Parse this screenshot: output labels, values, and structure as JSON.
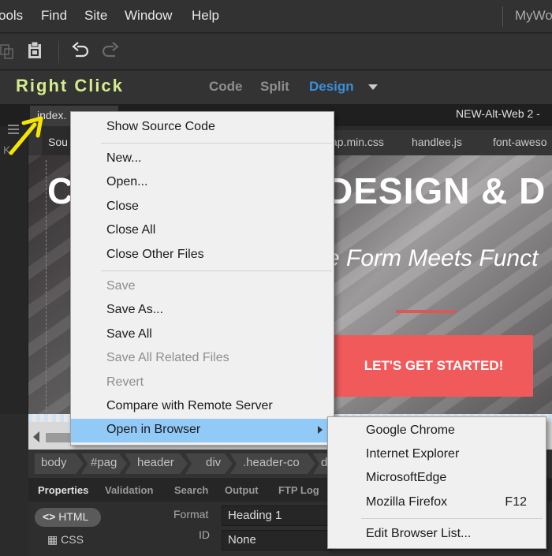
{
  "menubar": {
    "items": [
      "ools",
      "Find",
      "Site",
      "Window",
      "Help"
    ],
    "app_title": "MyWo"
  },
  "toolbar": {
    "icons": [
      "copy-icon",
      "paste-icon",
      "undo-icon",
      "redo-icon"
    ]
  },
  "viewbar": {
    "annotation": "Right Click",
    "code": "Code",
    "split": "Split",
    "design": "Design",
    "active": "Design"
  },
  "doc": {
    "tab_label": "index.",
    "path": "NEW-Alt-Web 2 -"
  },
  "related_files": {
    "source": "Sou",
    "files": [
      "ap.min.css",
      "handlee.js",
      "font-aweso"
    ]
  },
  "hero": {
    "title_left": "C",
    "title_right": "DESIGN & D",
    "subtitle": "e Form Meets Funct",
    "cta": "LET'S GET STARTED!",
    "cta_color": "#f05a5b"
  },
  "tags": [
    "body",
    "#pag",
    "header",
    "div",
    ".header-co",
    "d"
  ],
  "panels": {
    "tabs": [
      "Properties",
      "Validation",
      "Search",
      "Output",
      "FTP Log"
    ],
    "active": "Properties",
    "html_btn": "HTML",
    "css_btn": "CSS",
    "format_label": "Format",
    "format_value": "Heading 1",
    "id_label": "ID",
    "id_value": "None"
  },
  "context_menu": {
    "items": [
      {
        "label": "Show Source Code",
        "disabled": false
      },
      {
        "label": "New...",
        "disabled": false
      },
      {
        "label": "Open...",
        "disabled": false
      },
      {
        "label": "Close",
        "disabled": false
      },
      {
        "label": "Close All",
        "disabled": false
      },
      {
        "label": "Close Other Files",
        "disabled": false
      },
      {
        "label": "Save",
        "disabled": true
      },
      {
        "label": "Save As...",
        "disabled": false
      },
      {
        "label": "Save All",
        "disabled": false
      },
      {
        "label": "Save All Related Files",
        "disabled": true
      },
      {
        "label": "Revert",
        "disabled": true
      },
      {
        "label": "Compare with Remote Server",
        "disabled": false
      },
      {
        "label": "Open in Browser",
        "disabled": false,
        "highlighted": true,
        "submenu": true
      }
    ]
  },
  "browser_submenu": {
    "items": [
      {
        "label": "Google Chrome",
        "shortcut": ""
      },
      {
        "label": "Internet Explorer",
        "shortcut": ""
      },
      {
        "label": "MicrosoftEdge",
        "shortcut": ""
      },
      {
        "label": "Mozilla Firefox",
        "shortcut": "F12"
      },
      {
        "label": "Edit Browser List...",
        "shortcut": ""
      }
    ]
  },
  "colors": {
    "accent_blue": "#3a8fd9",
    "annotation_green": "#d6eb8e",
    "arrow_yellow": "#f5e600",
    "menu_highlight": "#91c9f7"
  }
}
